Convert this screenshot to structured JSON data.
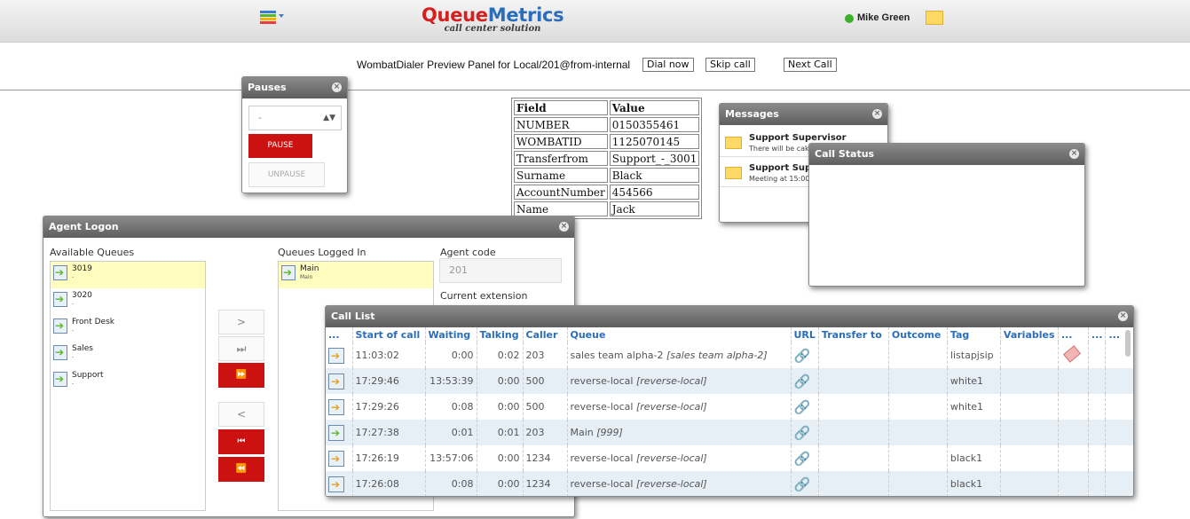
{
  "header": {
    "logo_queue": "Queue",
    "logo_metrics": "Metrics",
    "logo_sub": "call center solution",
    "user_name": "Mike Green"
  },
  "preview": {
    "text": "WombatDialer Preview Panel for Local/201@from-internal",
    "dial_now": "Dial now",
    "skip_call": "Skip call",
    "next_call": "Next Call"
  },
  "fields": {
    "head_field": "Field",
    "head_value": "Value",
    "rows": [
      {
        "field": "NUMBER",
        "value": "0150355461"
      },
      {
        "field": "WOMBATID",
        "value": "1125070145"
      },
      {
        "field": "Transferfrom",
        "value": "Support_-_3001"
      },
      {
        "field": "Surname",
        "value": "Black"
      },
      {
        "field": "AccountNumber",
        "value": "454566"
      },
      {
        "field": "Name",
        "value": "Jack"
      }
    ]
  },
  "pauses": {
    "title": "Pauses",
    "select_value": "-",
    "pause": "PAUSE",
    "unpause": "UNPAUSE"
  },
  "messages": {
    "title": "Messages",
    "items": [
      {
        "from": "Support Supervisor",
        "text": "There will be cake"
      },
      {
        "from": "Support Supervisor",
        "text": "Meeting at 15:00"
      }
    ]
  },
  "call_status": {
    "title": "Call Status"
  },
  "agent_logon": {
    "title": "Agent Logon",
    "available_label": "Available Queues",
    "logged_label": "Queues Logged In",
    "agent_code_label": "Agent code",
    "agent_code_placeholder": "201",
    "current_ext_label": "Current extension",
    "available": [
      {
        "name": "3019",
        "sub": "-"
      },
      {
        "name": "3020",
        "sub": "-"
      },
      {
        "name": "Front Desk",
        "sub": "-"
      },
      {
        "name": "Sales",
        "sub": "-"
      },
      {
        "name": "Support",
        "sub": "-"
      }
    ],
    "logged": [
      {
        "name": "Main",
        "sub": "Main"
      }
    ],
    "buttons": {
      "add": ">",
      "add_one": "⏭",
      "add_all": "⏩",
      "remove": "<",
      "remove_one": "⏮",
      "remove_all": "⏪"
    }
  },
  "call_list": {
    "title": "Call List",
    "headers": [
      "...",
      "Start of call",
      "Waiting",
      "Talking",
      "Caller",
      "Queue",
      "URL",
      "Transfer to",
      "Outcome",
      "Tag",
      "Variables",
      "...",
      "...",
      "..."
    ],
    "rows": [
      {
        "start": "11:03:02",
        "waiting": "0:00",
        "talking": "0:02",
        "caller": "203",
        "queue": "sales team alpha-2",
        "queue_alias": "[sales team alpha-2]",
        "tag": "listapjsip",
        "icon": "orange",
        "has_tag_icon": true
      },
      {
        "start": "17:29:46",
        "waiting": "13:53:39",
        "talking": "0:00",
        "caller": "500",
        "queue": "reverse-local",
        "queue_alias": "[reverse-local]",
        "tag": "white1",
        "icon": "orange",
        "has_tag_icon": false
      },
      {
        "start": "17:29:26",
        "waiting": "0:08",
        "talking": "0:00",
        "caller": "500",
        "queue": "reverse-local",
        "queue_alias": "[reverse-local]",
        "tag": "white1",
        "icon": "orange",
        "has_tag_icon": false
      },
      {
        "start": "17:27:38",
        "waiting": "0:01",
        "talking": "0:01",
        "caller": "203",
        "queue": "Main",
        "queue_alias": "[999]",
        "tag": "",
        "icon": "green",
        "has_tag_icon": false
      },
      {
        "start": "17:26:19",
        "waiting": "13:57:06",
        "talking": "0:00",
        "caller": "1234",
        "queue": "reverse-local",
        "queue_alias": "[reverse-local]",
        "tag": "black1",
        "icon": "orange",
        "has_tag_icon": false
      },
      {
        "start": "17:26:08",
        "waiting": "0:08",
        "talking": "0:00",
        "caller": "1234",
        "queue": "reverse-local",
        "queue_alias": "[reverse-local]",
        "tag": "black1",
        "icon": "orange",
        "has_tag_icon": false
      }
    ]
  },
  "colors": {
    "accent_red": "#cc1111",
    "link_blue": "#2a6ebb",
    "status_online": "#3cb02a",
    "row_alt": "#e6eef6",
    "selected_queue": "#fefcbf"
  },
  "icons": {
    "menu": "menu-grid-icon",
    "mail": "envelope-icon",
    "close": "close-icon",
    "queue": "queue-arrow-icon",
    "url": "link-chain-icon",
    "tag": "tag-icon"
  }
}
